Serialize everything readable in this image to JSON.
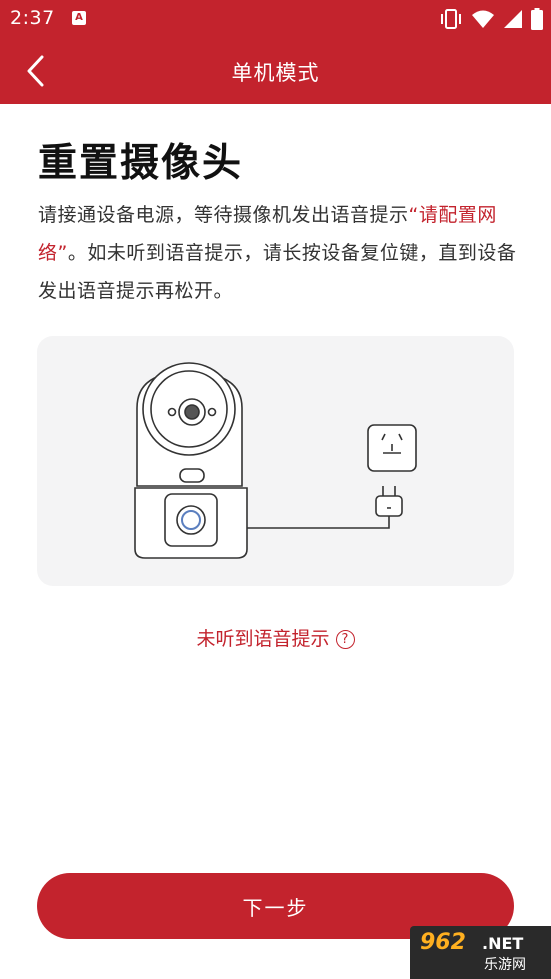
{
  "status_bar": {
    "time": "2:37",
    "notification_badge": "A"
  },
  "nav": {
    "title": "单机模式"
  },
  "page": {
    "title": "重置摄像头",
    "desc_part1": "请接通设备电源，等待摄像机发出语音提示",
    "desc_highlight": "“请配置网络”",
    "desc_part2": "。如未听到语音提示，请长按设备复位键，直到设备发出语音提示再松开。"
  },
  "help_link": {
    "label": "未听到语音提示"
  },
  "next_button": {
    "label": "下一步"
  },
  "watermark": {
    "brand": "962",
    "suffix": ".NET",
    "name": "乐游网"
  },
  "colors": {
    "primary": "#c3232d",
    "card_bg": "#f4f4f5"
  }
}
